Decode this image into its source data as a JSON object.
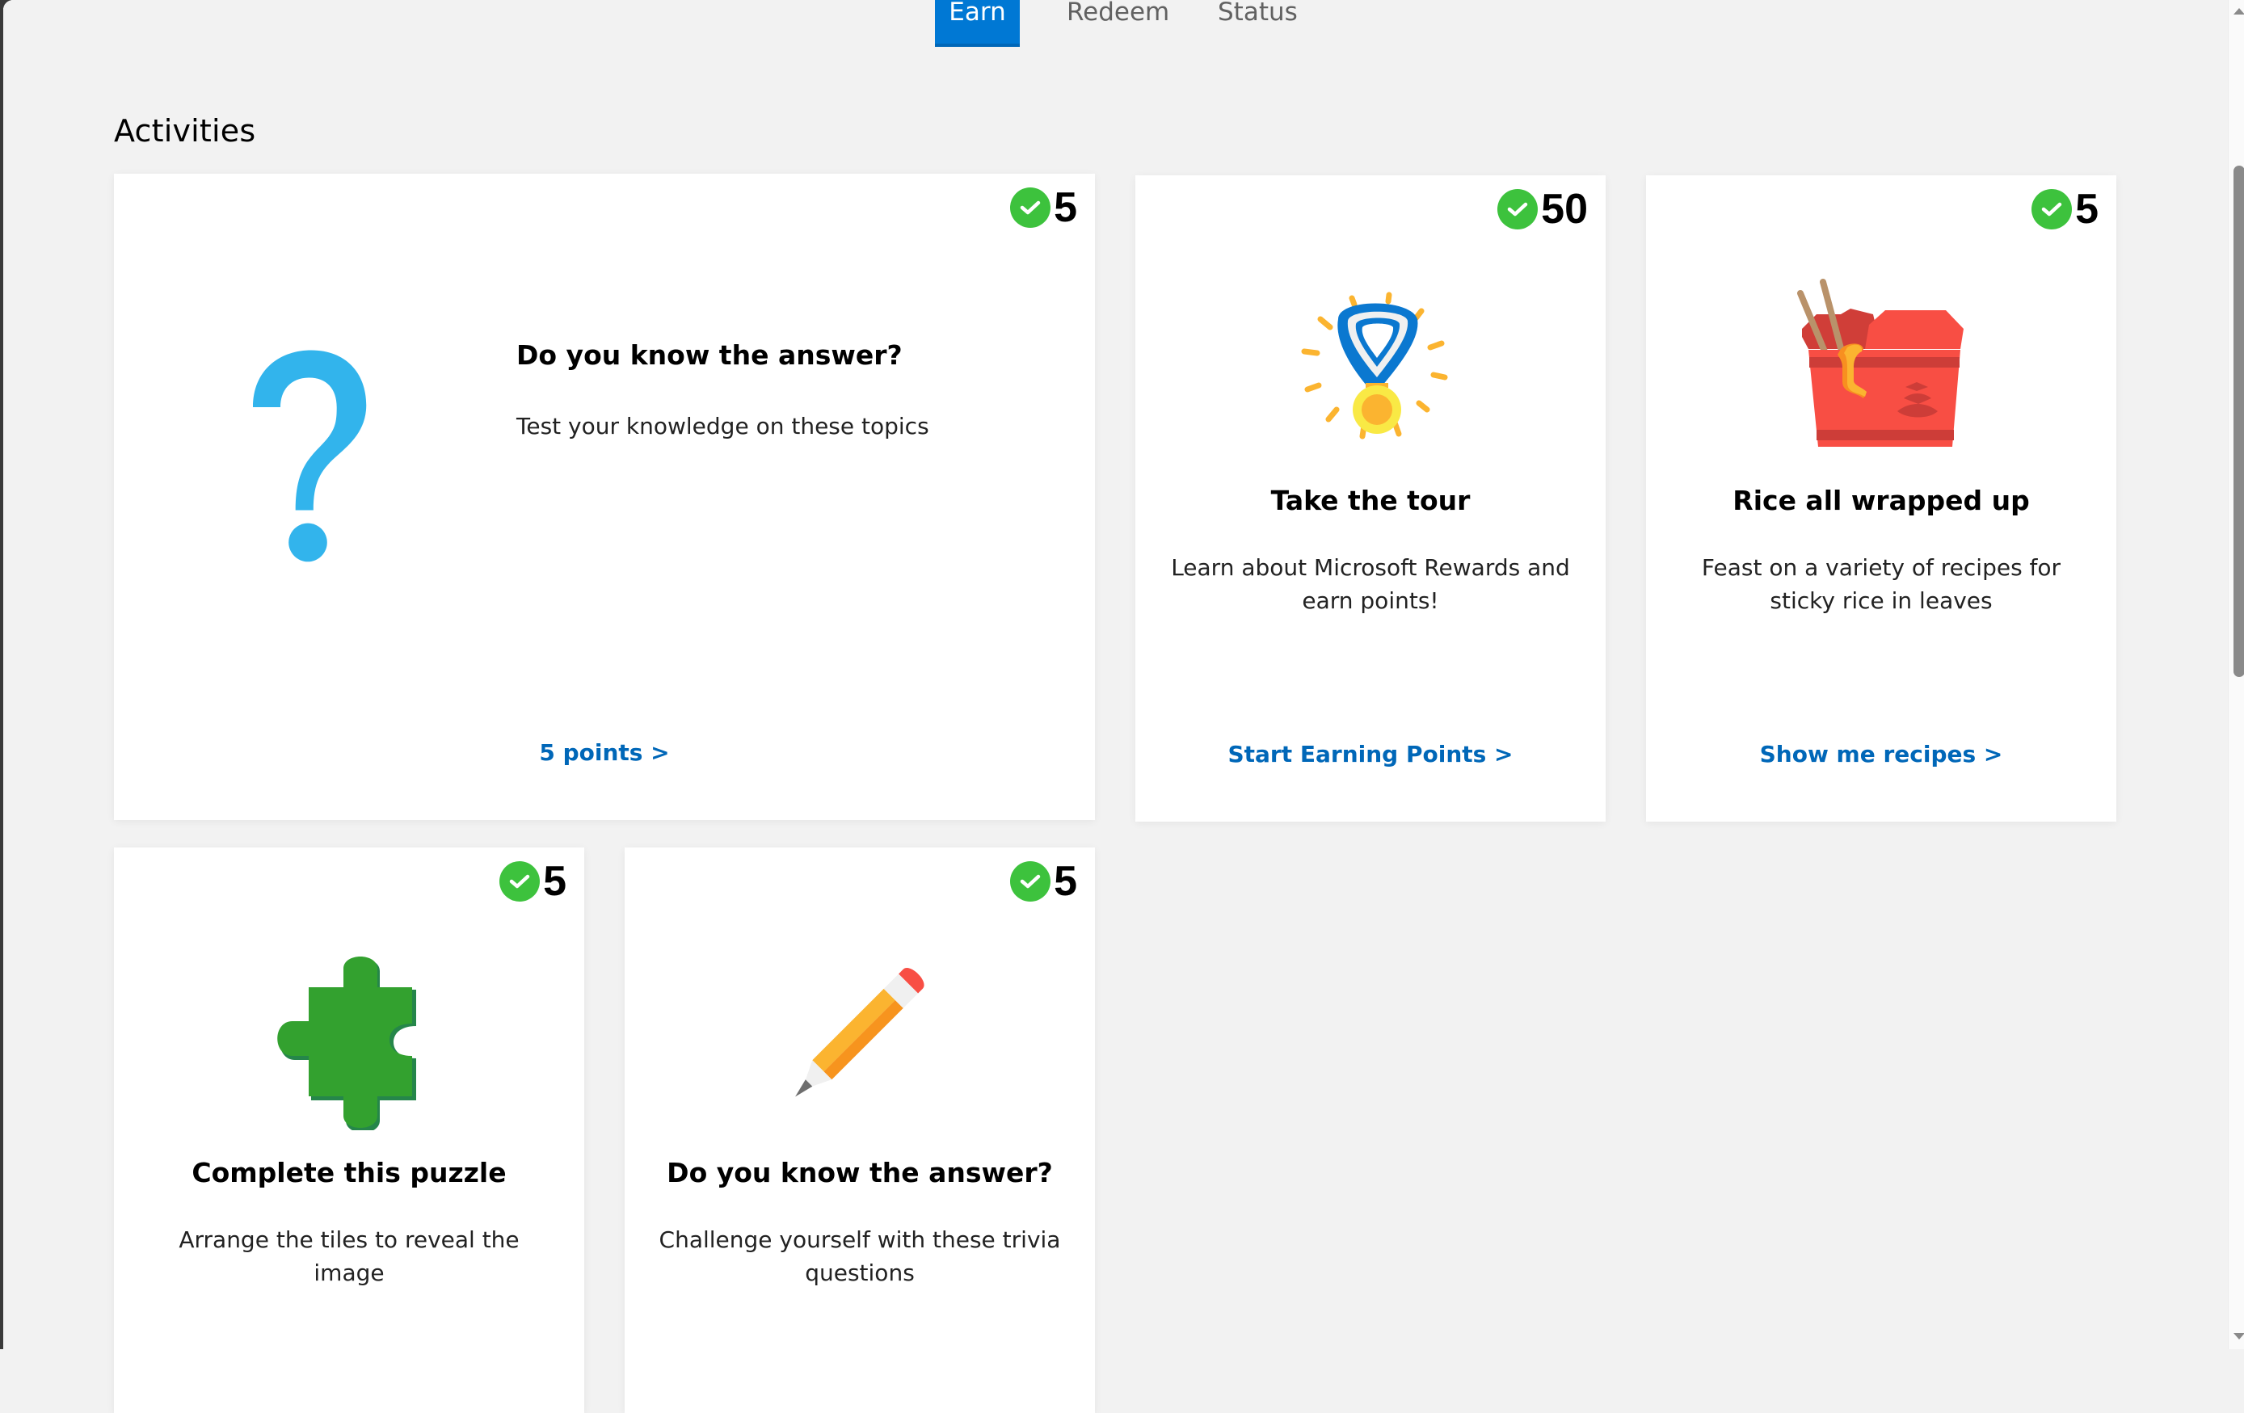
{
  "tabs": [
    {
      "label": "Earn",
      "active": true
    },
    {
      "label": "Redeem",
      "active": false
    },
    {
      "label": "Status",
      "active": false
    }
  ],
  "section_title": "Activities",
  "colors": {
    "accent": "#0078d4",
    "link": "#0067b8",
    "check": "#3dc23d",
    "background": "#f2f2f2"
  },
  "cards": [
    {
      "icon": "question-mark-icon",
      "points": "5",
      "completed": true,
      "title": "Do you know the answer?",
      "description": "Test your knowledge on these topics",
      "link": "5 points >"
    },
    {
      "icon": "medal-icon",
      "points": "50",
      "completed": true,
      "title": "Take the tour",
      "description": "Learn about Microsoft Rewards and earn points!",
      "link": "Start Earning Points >"
    },
    {
      "icon": "takeout-box-icon",
      "points": "5",
      "completed": true,
      "title": "Rice all wrapped up",
      "description": "Feast on a variety of recipes for sticky rice in leaves",
      "link": "Show me recipes >"
    },
    {
      "icon": "puzzle-piece-icon",
      "points": "5",
      "completed": true,
      "title": "Complete this puzzle",
      "description": "Arrange the tiles to reveal the image",
      "link": ""
    },
    {
      "icon": "pencil-icon",
      "points": "5",
      "completed": true,
      "title": "Do you know the answer?",
      "description": "Challenge yourself with these trivia questions",
      "link": ""
    }
  ]
}
